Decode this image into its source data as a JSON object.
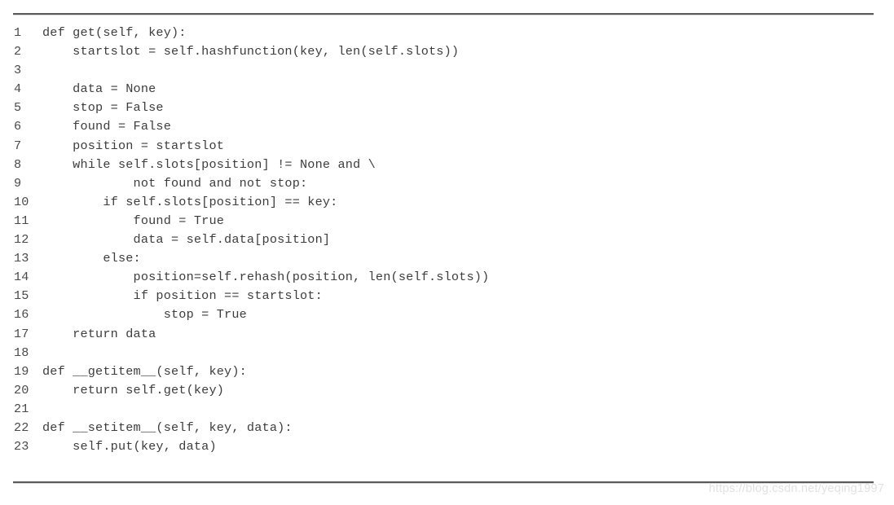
{
  "document": {
    "kind": "code-listing",
    "language": "Python",
    "title": "HashTable get / __getitem__ / __setitem__",
    "rule_color": "#5a5a5a",
    "text_color": "#3d3d3d",
    "background_color": "#ffffff",
    "line_number_color": "#4a4a4a"
  },
  "code": {
    "line_numbers": [
      "1",
      "2",
      "3",
      "4",
      "5",
      "6",
      "7",
      "8",
      "9",
      "10",
      "11",
      "12",
      "13",
      "14",
      "15",
      "16",
      "17",
      "18",
      "19",
      "20",
      "21",
      "22",
      "23"
    ],
    "lines": [
      "def get(self, key):",
      "    startslot = self.hashfunction(key, len(self.slots))",
      "",
      "    data = None",
      "    stop = False",
      "    found = False",
      "    position = startslot",
      "    while self.slots[position] != None and \\",
      "            not found and not stop:",
      "        if self.slots[position] == key:",
      "            found = True",
      "            data = self.data[position]",
      "        else:",
      "            position=self.rehash(position, len(self.slots))",
      "            if position == startslot:",
      "                stop = True",
      "    return data",
      "",
      "def __getitem__(self, key):",
      "    return self.get(key)",
      "",
      "def __setitem__(self, key, data):",
      "    self.put(key, data)"
    ]
  },
  "watermark": {
    "text": "https://blog.csdn.net/yeqing1997",
    "color": "#e2e2e2"
  }
}
